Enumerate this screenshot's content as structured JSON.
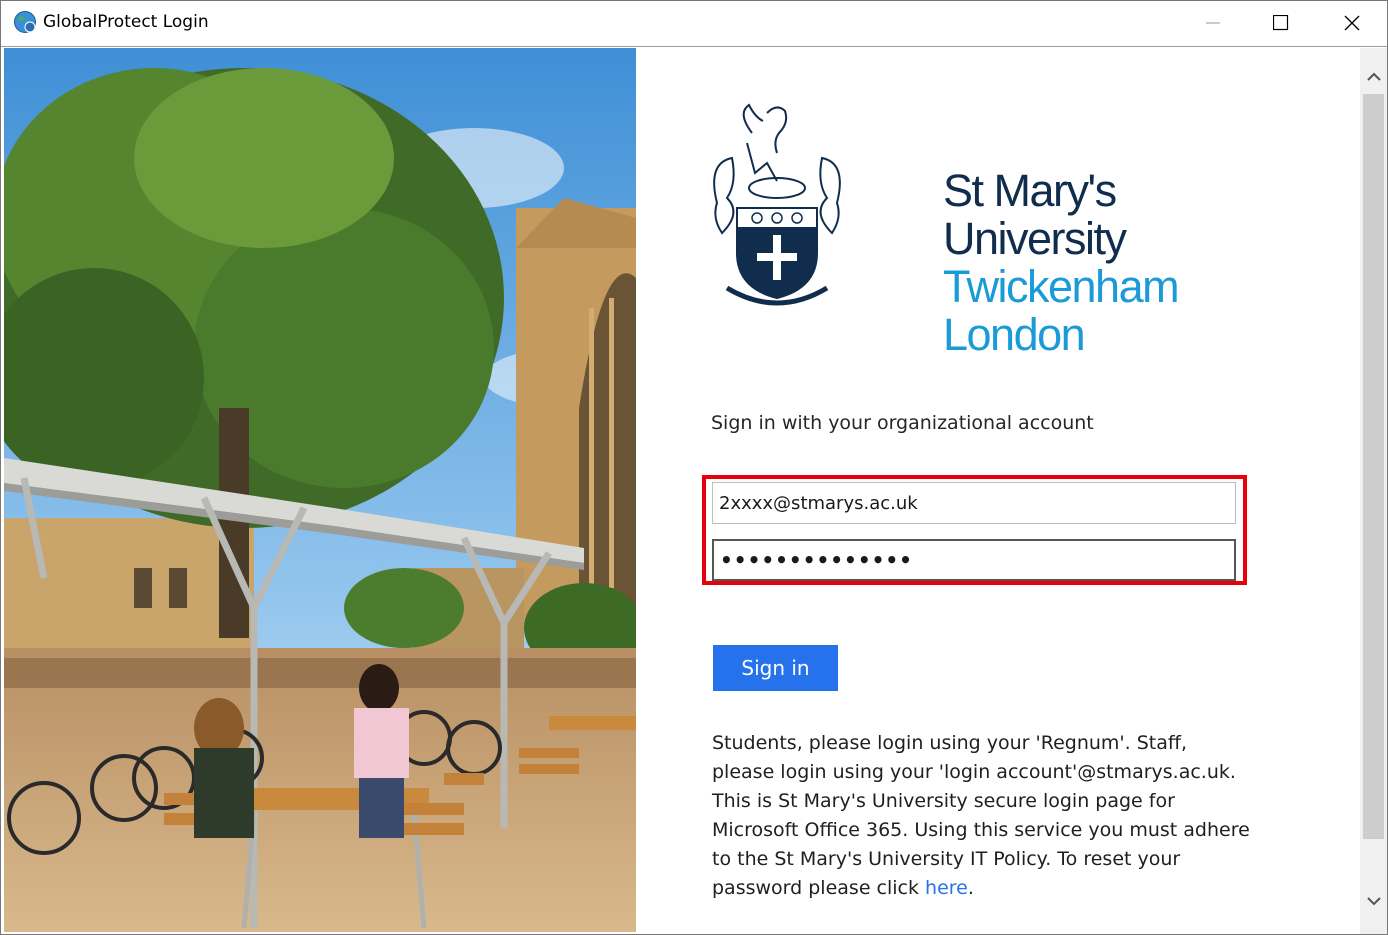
{
  "window": {
    "title": "GlobalProtect Login",
    "icon": "globe-icon"
  },
  "titlebar_buttons": {
    "minimize": "minimize-icon",
    "maximize": "maximize-icon",
    "close": "close-icon"
  },
  "logo": {
    "line1": "St Mary's",
    "line2": "University",
    "line3": "Twickenham",
    "line4": "London",
    "colors": {
      "dark": "#112d4e",
      "light": "#1a9bd7"
    }
  },
  "form": {
    "heading": "Sign in with your organizational account",
    "username_value": "2xxxx@stmarys.ac.uk",
    "password_dots": "••••••••••••••",
    "signin_label": "Sign in",
    "highlight_color": "#e8000b",
    "button_color": "#2672ec"
  },
  "help": {
    "text": "Students, please login using your 'Regnum'. Staff, please login using your 'login account'@stmarys.ac.uk. This is St Mary's University secure login page for Microsoft Office 365. Using this service you must adhere to the St Mary's University IT Policy. To reset your password please click ",
    "link": "here",
    "suffix": "."
  }
}
